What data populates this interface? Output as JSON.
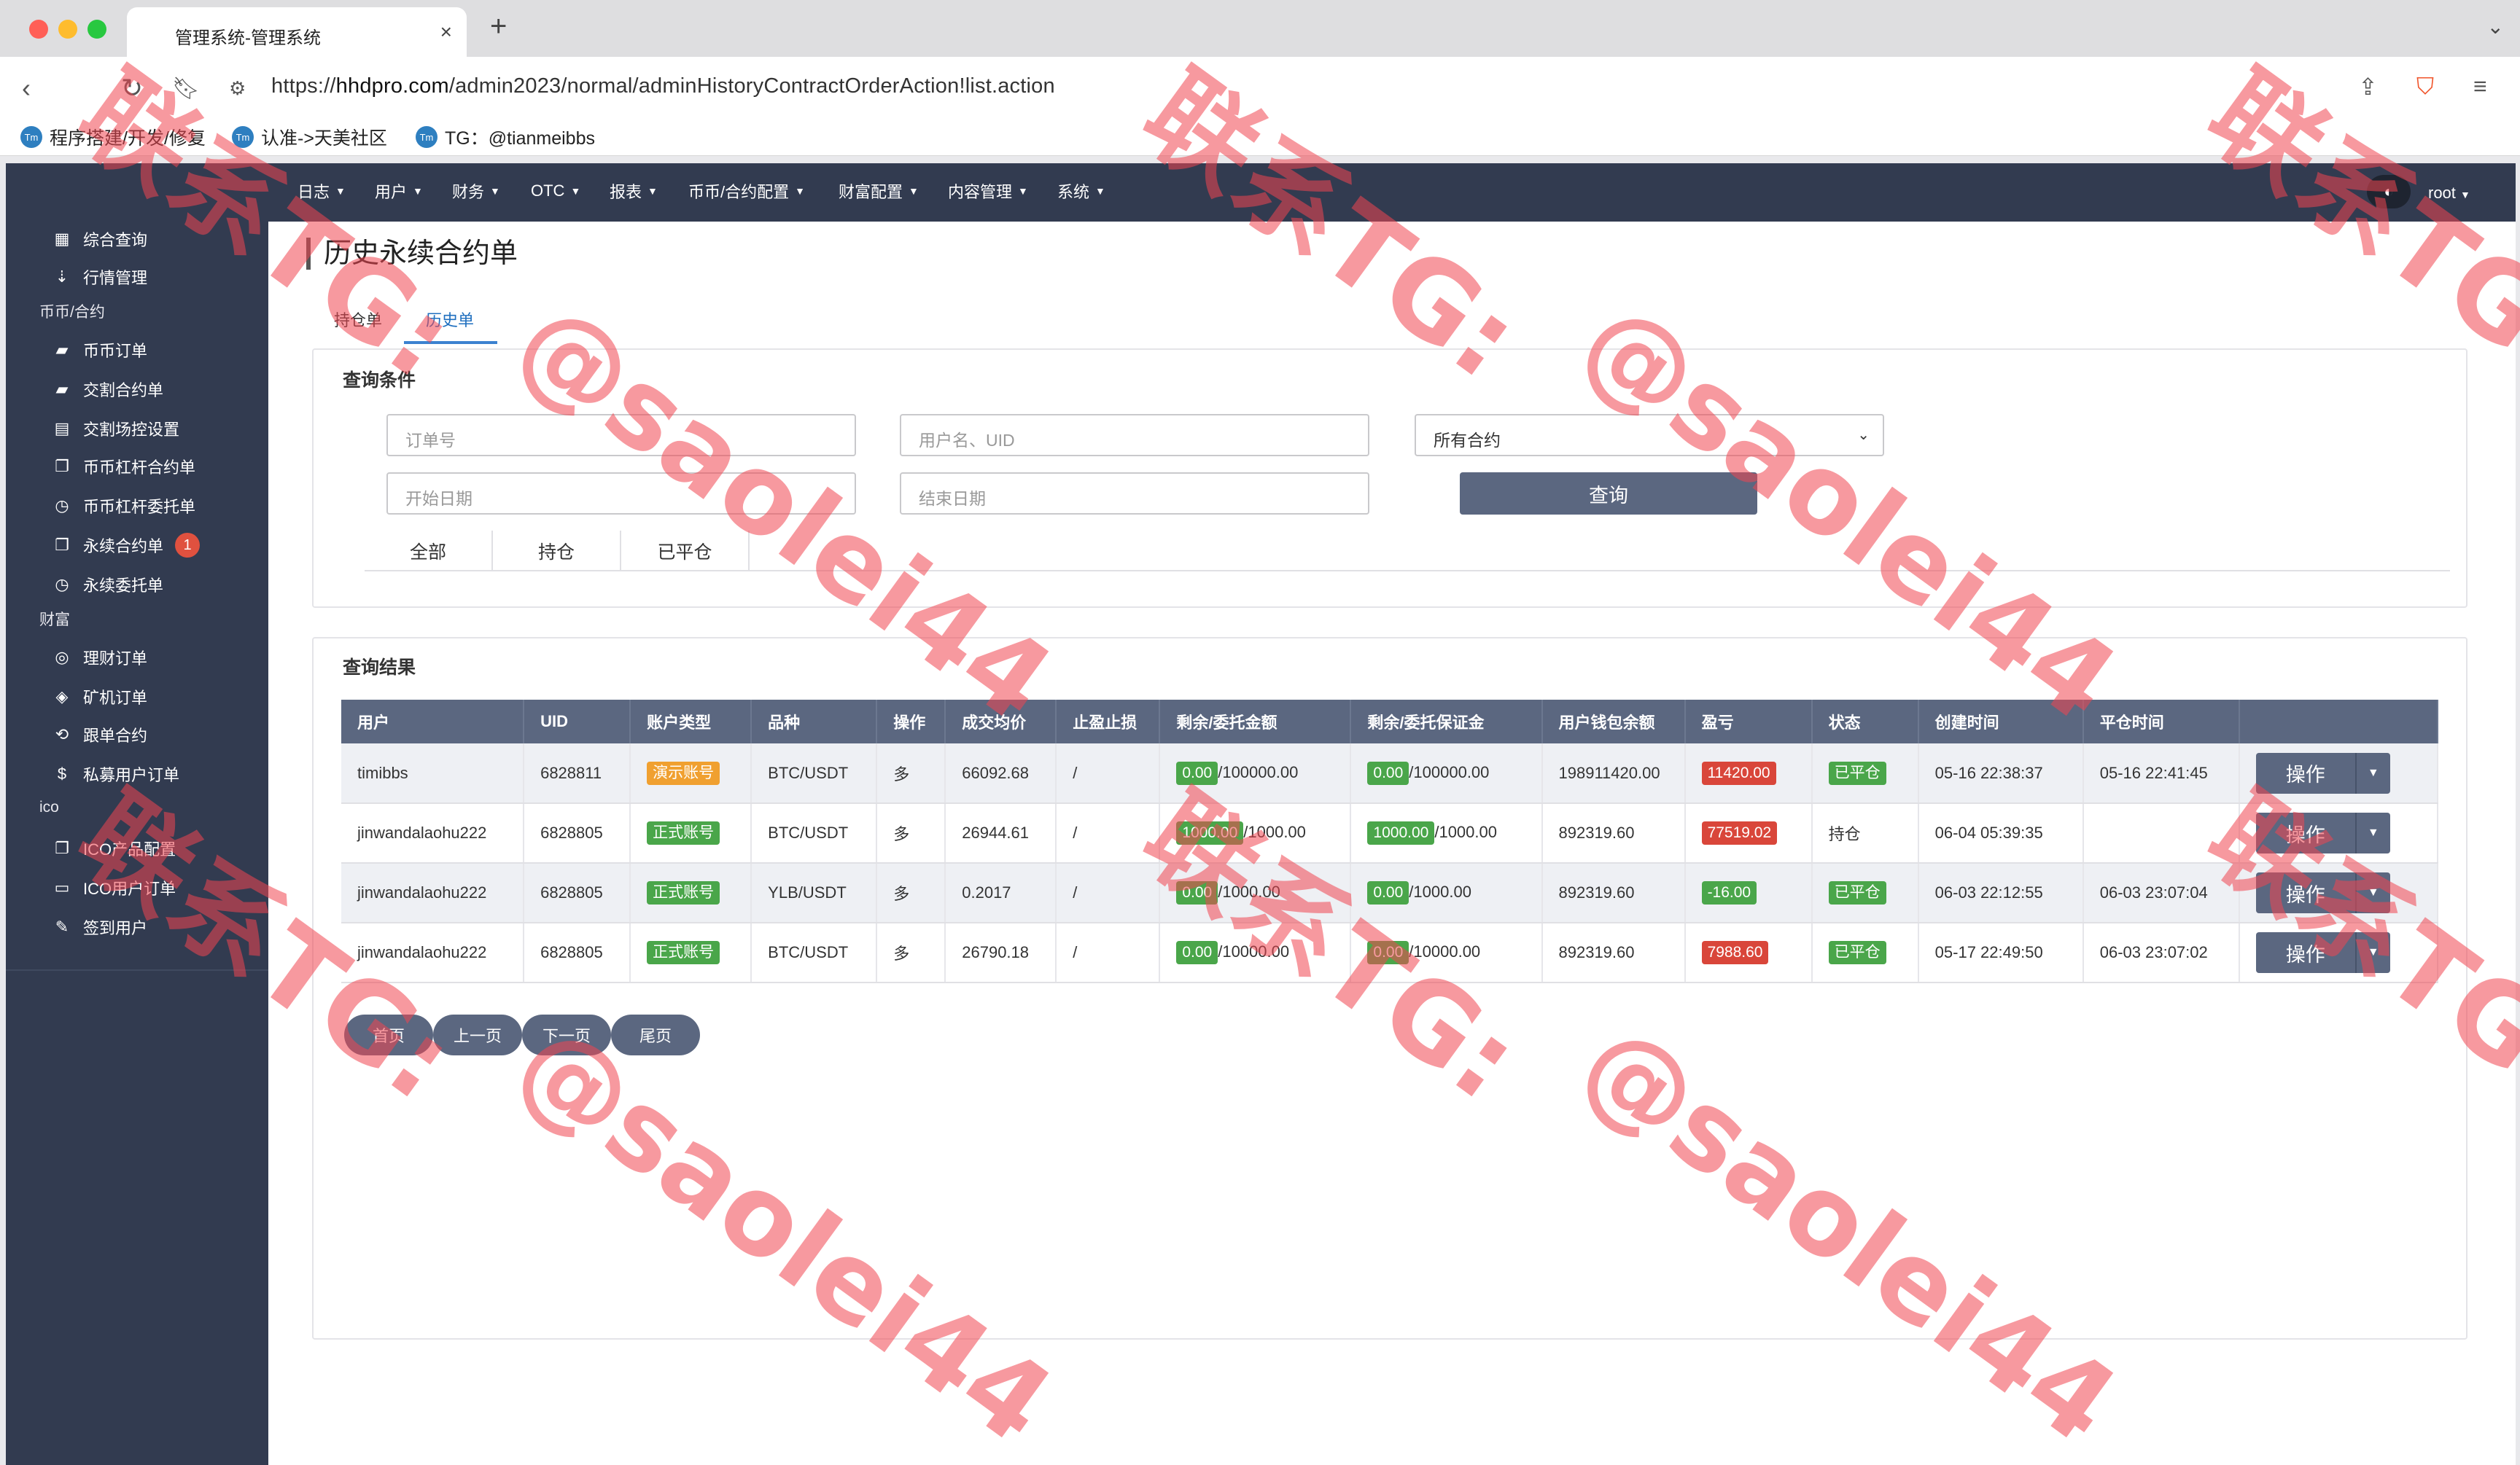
{
  "browser": {
    "tab_title": "管理系统-管理系统",
    "url_prefix": "https://",
    "url_host": "hhdpro.com",
    "url_path": "/admin2023/normal/adminHistoryContractOrderAction!list.action",
    "bookmarks": [
      {
        "label": "程序搭建/开发/修复",
        "icon": "tm-icon"
      },
      {
        "label": "认准->天美社区",
        "icon": "tm-icon"
      },
      {
        "label": "TG：@tianmeibbs",
        "icon": "tm-icon"
      }
    ]
  },
  "topnav": {
    "items": [
      "日志",
      "用户",
      "财务",
      "OTC",
      "报表",
      "币币/合约配置",
      "财富配置",
      "内容管理",
      "系统"
    ],
    "user": "root"
  },
  "sidebar": {
    "top_items": [
      {
        "label": "综合查询",
        "icon": "grid-icon"
      },
      {
        "label": "行情管理",
        "icon": "sort-icon"
      }
    ],
    "sections": [
      {
        "title": "币币/合约",
        "items": [
          {
            "label": "币币订单",
            "icon": "bookmark-icon"
          },
          {
            "label": "交割合约单",
            "icon": "bookmark-icon"
          },
          {
            "label": "交割场控设置",
            "icon": "clipboard-icon"
          },
          {
            "label": "币币杠杆合约单",
            "icon": "copy-icon"
          },
          {
            "label": "币币杠杆委托单",
            "icon": "clock-doc-icon"
          },
          {
            "label": "永续合约单",
            "icon": "copy-icon",
            "badge": "1"
          },
          {
            "label": "永续委托单",
            "icon": "clock-doc-icon"
          }
        ]
      },
      {
        "title": "财富",
        "items": [
          {
            "label": "理财订单",
            "icon": "coins-icon"
          },
          {
            "label": "矿机订单",
            "icon": "layers-icon"
          },
          {
            "label": "跟单合约",
            "icon": "refresh-doc-icon"
          },
          {
            "label": "私募用户订单",
            "icon": "dollar-icon"
          }
        ]
      },
      {
        "title": "ico",
        "items": [
          {
            "label": "ICO产品配置",
            "icon": "copy-icon"
          },
          {
            "label": "ICO用户订单",
            "icon": "monitor-icon"
          },
          {
            "label": "签到用户",
            "icon": "edit-icon"
          }
        ]
      }
    ]
  },
  "page": {
    "title": "历史永续合约单",
    "subtabs": [
      "持仓单",
      "历史单"
    ],
    "active_subtab": "历史单"
  },
  "query": {
    "title": "查询条件",
    "order_no_placeholder": "订单号",
    "user_placeholder": "用户名、UID",
    "contract_selected": "所有合约",
    "start_date_placeholder": "开始日期",
    "end_date_placeholder": "结束日期",
    "query_button": "查询",
    "filter_tabs": [
      "全部",
      "持仓",
      "已平仓"
    ]
  },
  "results": {
    "title": "查询结果",
    "columns": [
      "用户",
      "UID",
      "账户类型",
      "品种",
      "操作",
      "成交均价",
      "止盈止损",
      "剩余/委托金额",
      "剩余/委托保证金",
      "用户钱包余额",
      "盈亏",
      "状态",
      "创建时间",
      "平仓时间"
    ],
    "rows": [
      {
        "user": "timibbs",
        "uid": "6828811",
        "account_type": "演示账号",
        "account_color": "#f0a030",
        "symbol": "BTC/USDT",
        "direction": "多",
        "avg_price": "66092.68",
        "tp_sl": "/",
        "amount_remain": "0.00",
        "amount_total": "/100000.00",
        "margin_remain": "0.00",
        "margin_total": "/100000.00",
        "wallet": "198911420.00",
        "pnl": "11420.00",
        "pnl_color": "#d9463a",
        "status": "已平仓",
        "status_tag": true,
        "created": "05-16 22:38:37",
        "closed": "05-16 22:41:45",
        "op": "操作"
      },
      {
        "user": "jinwandalaohu222",
        "uid": "6828805",
        "account_type": "正式账号",
        "account_color": "#4aa64a",
        "symbol": "BTC/USDT",
        "direction": "多",
        "avg_price": "26944.61",
        "tp_sl": "/",
        "amount_remain": "1000.00",
        "amount_total": "/1000.00",
        "margin_remain": "1000.00",
        "margin_total": "/1000.00",
        "wallet": "892319.60",
        "pnl": "77519.02",
        "pnl_color": "#d9463a",
        "status": "持仓",
        "status_tag": false,
        "created": "06-04 05:39:35",
        "closed": "",
        "op": "操作"
      },
      {
        "user": "jinwandalaohu222",
        "uid": "6828805",
        "account_type": "正式账号",
        "account_color": "#4aa64a",
        "symbol": "YLB/USDT",
        "direction": "多",
        "avg_price": "0.2017",
        "tp_sl": "/",
        "amount_remain": "0.00",
        "amount_total": "/1000.00",
        "margin_remain": "0.00",
        "margin_total": "/1000.00",
        "wallet": "892319.60",
        "pnl": "-16.00",
        "pnl_color": "#4aa64a",
        "status": "已平仓",
        "status_tag": true,
        "created": "06-03 22:12:55",
        "closed": "06-03 23:07:04",
        "op": "操作"
      },
      {
        "user": "jinwandalaohu222",
        "uid": "6828805",
        "account_type": "正式账号",
        "account_color": "#4aa64a",
        "symbol": "BTC/USDT",
        "direction": "多",
        "avg_price": "26790.18",
        "tp_sl": "/",
        "amount_remain": "0.00",
        "amount_total": "/10000.00",
        "margin_remain": "0.00",
        "margin_total": "/10000.00",
        "wallet": "892319.60",
        "pnl": "7988.60",
        "pnl_color": "#d9463a",
        "status": "已平仓",
        "status_tag": true,
        "created": "05-17 22:49:50",
        "closed": "06-03 23:07:02",
        "op": "操作"
      }
    ],
    "pager": [
      "首页",
      "上一页",
      "下一页",
      "尾页"
    ]
  },
  "watermark": {
    "tg": "联系TG:",
    "handle": "@saolei44"
  },
  "colors": {
    "nav_bg": "#323b50",
    "button_bg": "#5b6780",
    "tag_green": "#4aa64a",
    "tag_red": "#d9463a",
    "tag_orange": "#f0a030",
    "watermark": "rgba(240,70,80,0.55)"
  }
}
